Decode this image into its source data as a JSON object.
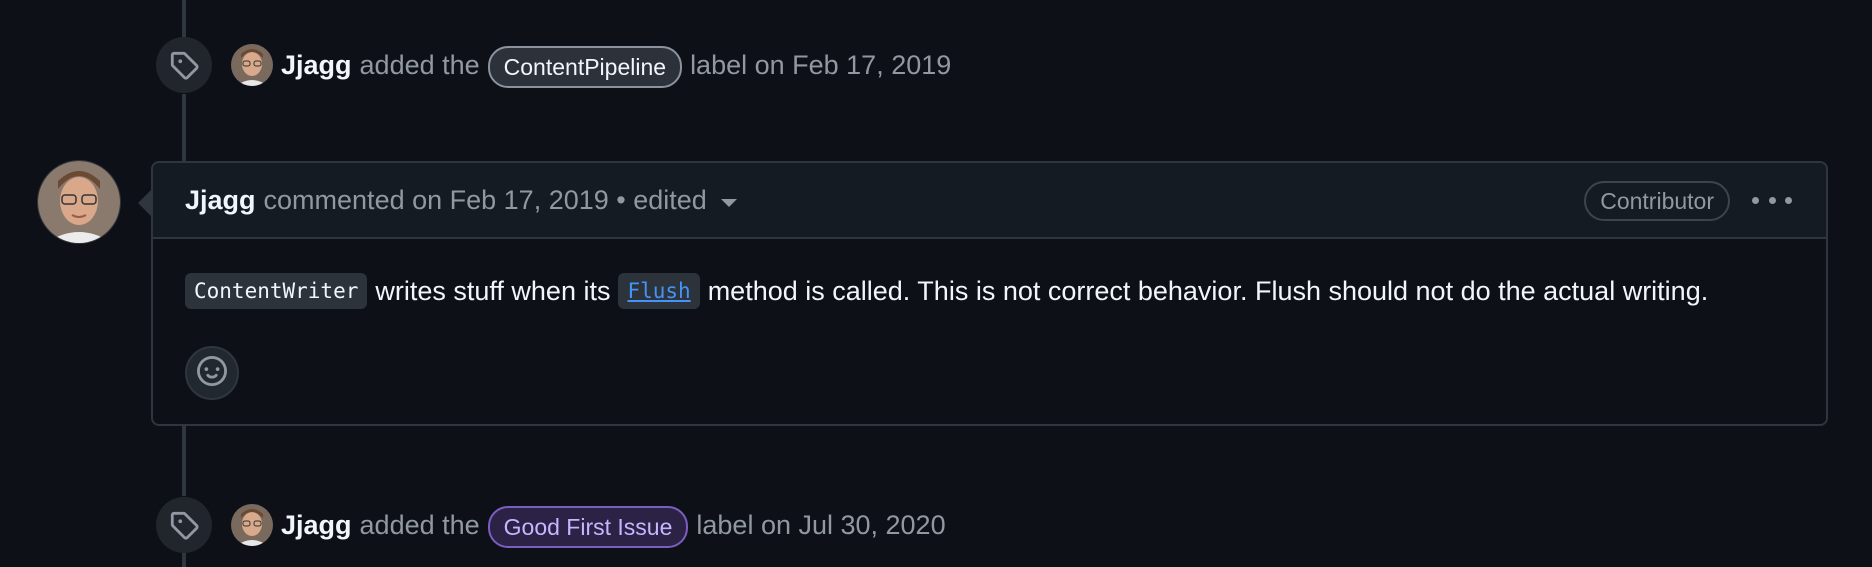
{
  "events": [
    {
      "author": "Jjagg",
      "action": "added the",
      "label": "ContentPipeline",
      "suffix": "label on Feb 17, 2019"
    },
    {
      "author": "Jjagg",
      "action": "added the",
      "label": "Good First Issue",
      "suffix": "label on Jul 30, 2020"
    }
  ],
  "comment": {
    "author": "Jjagg",
    "meta": "commented on Feb 17, 2019 • edited",
    "role_badge": "Contributor",
    "body": {
      "code1": "ContentWriter",
      "text1": "writes stuff when its",
      "code2": "Flush",
      "text2": "method is called. This is not correct behavior. Flush should not do the actual writing."
    }
  },
  "icons": {
    "event_icon": "tag-icon",
    "reaction": "smiley-icon",
    "menu": "kebab-horizontal-icon",
    "dropdown": "triangle-down-icon"
  },
  "colors": {
    "background": "#0d1117",
    "label_contentpipeline": "#8b949e",
    "label_goodfirstissue": "#7a5fc0",
    "link": "#4493f8"
  }
}
